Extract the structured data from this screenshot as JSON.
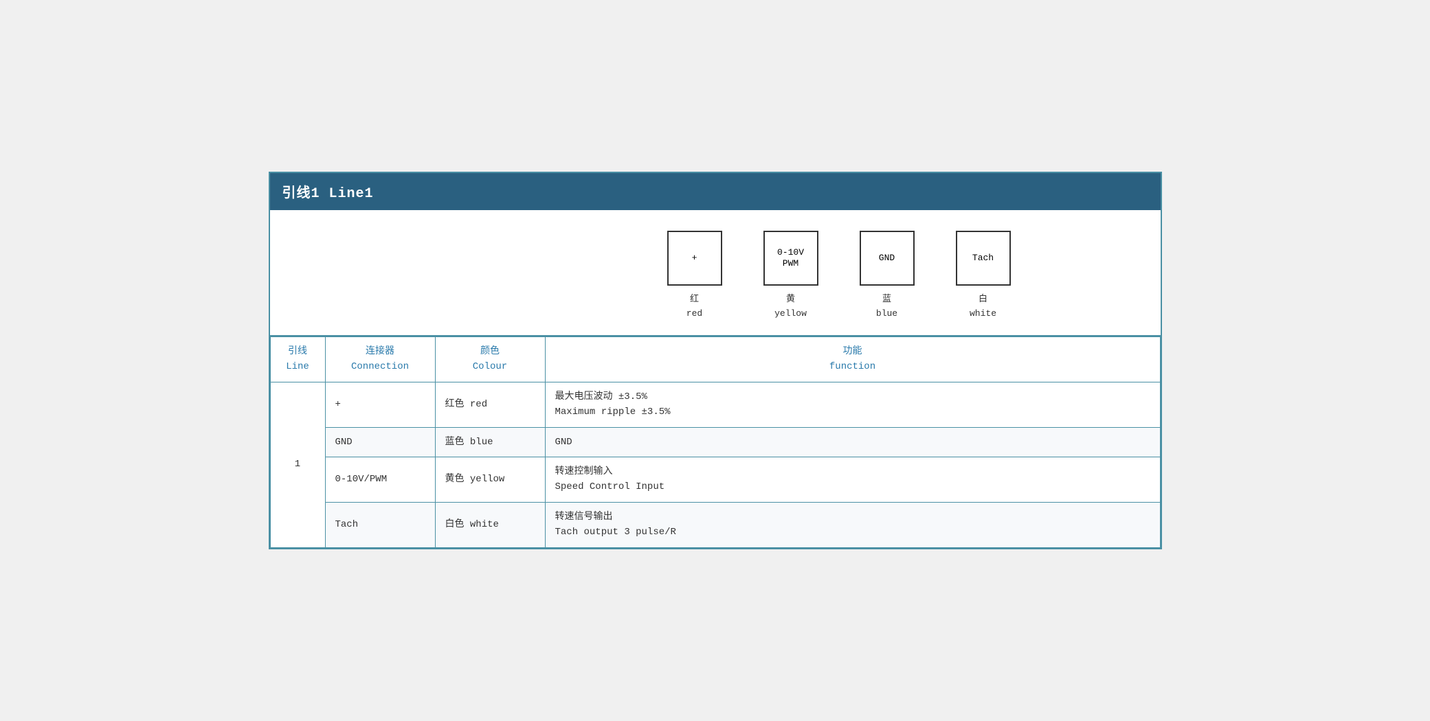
{
  "header": {
    "title": "引线1 Line1"
  },
  "diagram": {
    "connectors": [
      {
        "id": "plus",
        "box_label": "+",
        "label_cn": "红",
        "label_en": "red"
      },
      {
        "id": "pwm",
        "box_label": "0-10V\nPWM",
        "label_cn": "黄",
        "label_en": "yellow"
      },
      {
        "id": "gnd",
        "box_label": "GND",
        "label_cn": "蓝",
        "label_en": "blue"
      },
      {
        "id": "tach",
        "box_label": "Tach",
        "label_cn": "白",
        "label_en": "white"
      }
    ]
  },
  "table": {
    "columns": {
      "line_cn": "引线",
      "line_en": "Line",
      "connection_cn": "连接器",
      "connection_en": "Connection",
      "colour_cn": "颜色",
      "colour_en": "Colour",
      "function_cn": "功能",
      "function_en": "function"
    },
    "rows": [
      {
        "line": "1",
        "connection": "+",
        "colour_cn": "红色 red",
        "function_cn": "最大电压波动 ±3.5%",
        "function_en": "Maximum ripple ±3.5%"
      },
      {
        "line": "",
        "connection": "GND",
        "colour_cn": "蓝色 blue",
        "function_cn": "GND",
        "function_en": ""
      },
      {
        "line": "",
        "connection": "0-10V/PWM",
        "colour_cn": "黄色 yellow",
        "function_cn": "转速控制输入",
        "function_en": "Speed Control Input"
      },
      {
        "line": "",
        "connection": "Tach",
        "colour_cn": "白色 white",
        "function_cn": "转速信号输出",
        "function_en": "Tach output 3 pulse/R"
      }
    ]
  }
}
